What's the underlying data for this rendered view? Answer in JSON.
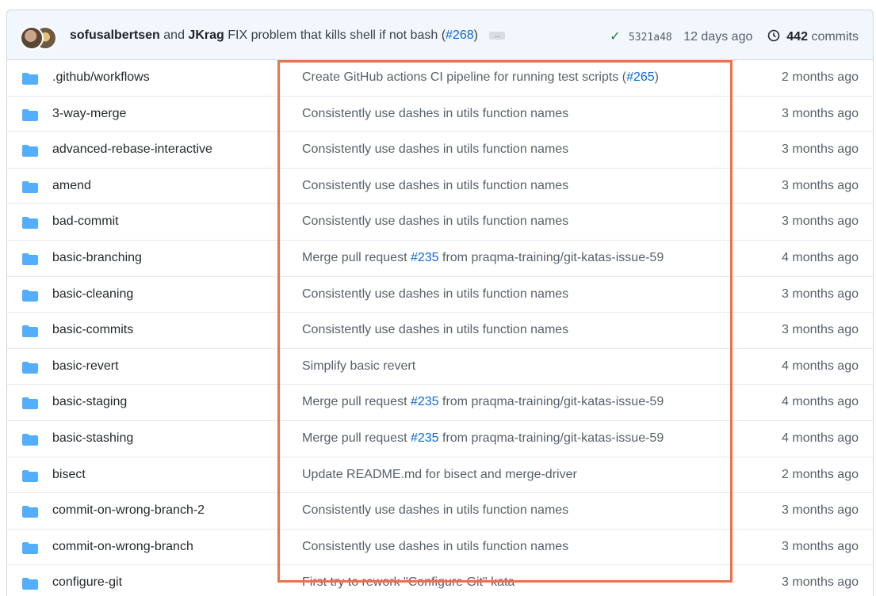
{
  "latest_commit": {
    "author1": "sofusalbertsen",
    "joiner": "and",
    "author2": "JKrag",
    "message": "FIX problem that kills shell if not bash",
    "pr_open": "(",
    "pr_number": "#268",
    "pr_close": ")",
    "ellipsis": "…",
    "sha": "5321a48",
    "age": "12 days ago",
    "commit_count": "442",
    "commits_label": "commits"
  },
  "colors": {
    "link": "#0969da",
    "folder": "#54aeff",
    "highlight_border": "#e8734a",
    "check": "#1a7f37"
  },
  "rows": [
    {
      "name": ".github/workflows",
      "msg_pre": "Create GitHub actions CI pipeline for running test scripts (",
      "msg_link": "#265",
      "msg_post": ")",
      "age": "2 months ago"
    },
    {
      "name": "3-way-merge",
      "msg_pre": "Consistently use dashes in utils function names",
      "msg_link": "",
      "msg_post": "",
      "age": "3 months ago"
    },
    {
      "name": "advanced-rebase-interactive",
      "msg_pre": "Consistently use dashes in utils function names",
      "msg_link": "",
      "msg_post": "",
      "age": "3 months ago"
    },
    {
      "name": "amend",
      "msg_pre": "Consistently use dashes in utils function names",
      "msg_link": "",
      "msg_post": "",
      "age": "3 months ago"
    },
    {
      "name": "bad-commit",
      "msg_pre": "Consistently use dashes in utils function names",
      "msg_link": "",
      "msg_post": "",
      "age": "3 months ago"
    },
    {
      "name": "basic-branching",
      "msg_pre": "Merge pull request ",
      "msg_link": "#235",
      "msg_post": " from praqma-training/git-katas-issue-59",
      "age": "4 months ago"
    },
    {
      "name": "basic-cleaning",
      "msg_pre": "Consistently use dashes in utils function names",
      "msg_link": "",
      "msg_post": "",
      "age": "3 months ago"
    },
    {
      "name": "basic-commits",
      "msg_pre": "Consistently use dashes in utils function names",
      "msg_link": "",
      "msg_post": "",
      "age": "3 months ago"
    },
    {
      "name": "basic-revert",
      "msg_pre": "Simplify basic revert",
      "msg_link": "",
      "msg_post": "",
      "age": "4 months ago"
    },
    {
      "name": "basic-staging",
      "msg_pre": "Merge pull request ",
      "msg_link": "#235",
      "msg_post": " from praqma-training/git-katas-issue-59",
      "age": "4 months ago"
    },
    {
      "name": "basic-stashing",
      "msg_pre": "Merge pull request ",
      "msg_link": "#235",
      "msg_post": " from praqma-training/git-katas-issue-59",
      "age": "4 months ago"
    },
    {
      "name": "bisect",
      "msg_pre": "Update README.md for bisect and merge-driver",
      "msg_link": "",
      "msg_post": "",
      "age": "2 months ago"
    },
    {
      "name": "commit-on-wrong-branch-2",
      "msg_pre": "Consistently use dashes in utils function names",
      "msg_link": "",
      "msg_post": "",
      "age": "3 months ago"
    },
    {
      "name": "commit-on-wrong-branch",
      "msg_pre": "Consistently use dashes in utils function names",
      "msg_link": "",
      "msg_post": "",
      "age": "3 months ago"
    },
    {
      "name": "configure-git",
      "msg_pre": "First try to rework \"Configure Git\" kata",
      "msg_link": "",
      "msg_post": "",
      "age": "3 months ago"
    }
  ]
}
